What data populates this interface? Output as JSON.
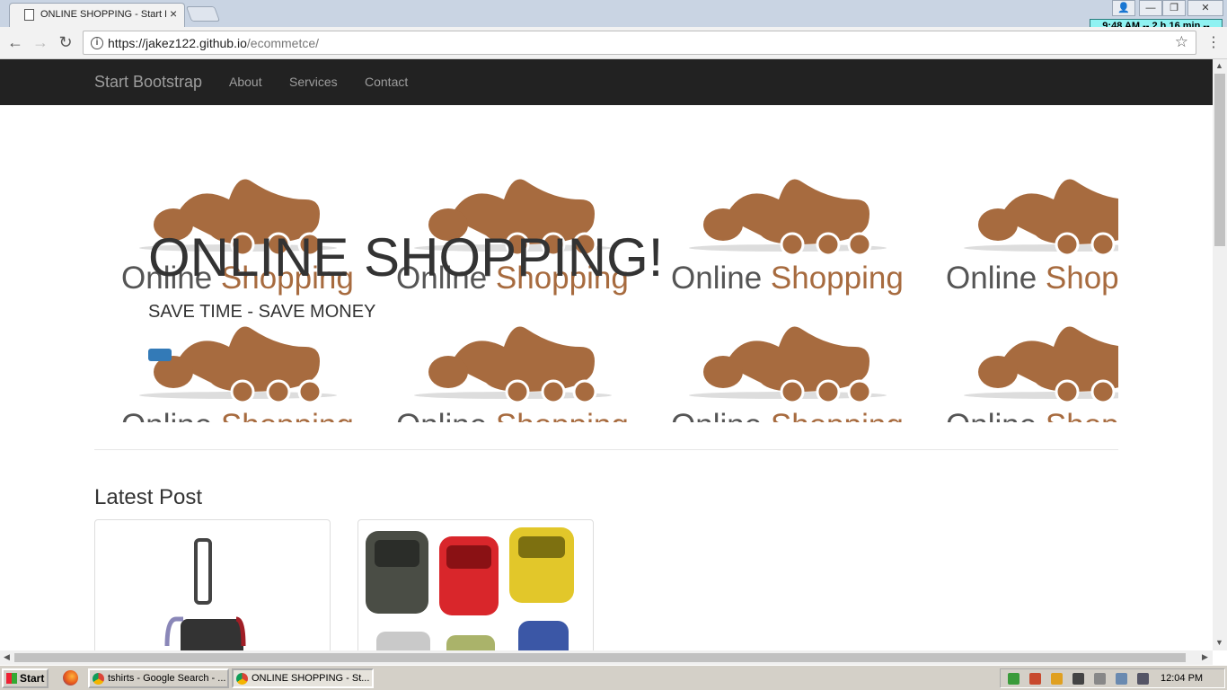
{
  "browser": {
    "tab_title": "ONLINE SHOPPING - Start B",
    "tab_close": "×",
    "url_host": "https://jakez122.github.io",
    "url_path": "/ecommetce/",
    "clock_badge": "9:48 AM -- 2 h 16 min --",
    "back": "←",
    "forward": "→",
    "reload": "↻",
    "info": "i",
    "star": "☆",
    "menu": "⋮",
    "win_buttons": [
      "👤",
      "—",
      "❐",
      "✕"
    ]
  },
  "navbar": {
    "brand": "Start Bootstrap",
    "links": [
      "About",
      "Services",
      "Contact"
    ]
  },
  "hero": {
    "title": "ONLINE SHOPPING!",
    "subtitle": "SAVE TIME - SAVE MONEY",
    "logo_word_1": "Online",
    "logo_word_2": "Shopping",
    "accent_color": "#a76b3f",
    "button_color": "#337ab7"
  },
  "content": {
    "section_title": "Latest Post",
    "cards": [
      {
        "image": "luggage-image"
      },
      {
        "image": "cars-image"
      }
    ]
  },
  "scrollbars": {
    "up": "▲",
    "down": "▼",
    "left": "◀",
    "right": "▶"
  },
  "taskbar": {
    "start": "Start",
    "items": [
      {
        "label": "tshirts - Google Search - ...",
        "active": false
      },
      {
        "label": "ONLINE SHOPPING - St...",
        "active": true
      }
    ],
    "time": "12:04 PM"
  }
}
